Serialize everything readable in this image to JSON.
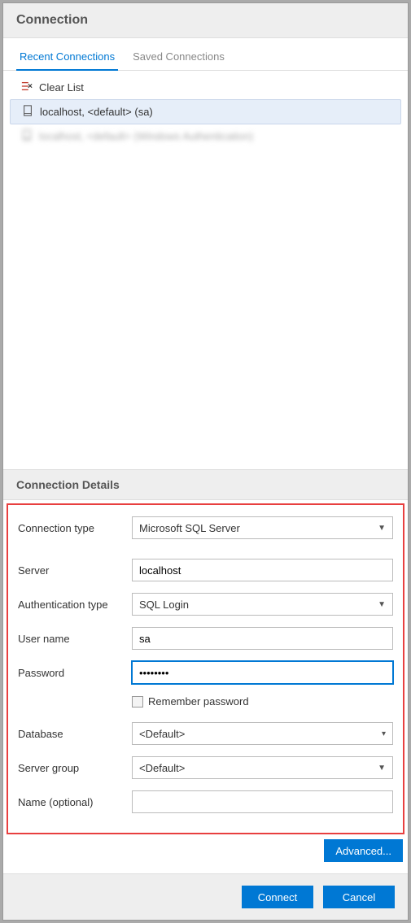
{
  "header": {
    "title": "Connection"
  },
  "tabs": {
    "recent": "Recent Connections",
    "saved": "Saved Connections"
  },
  "list": {
    "clear": "Clear List",
    "item1": "localhost, <default> (sa)",
    "item2": "localhost, <default> (Windows Authentication)"
  },
  "details": {
    "sectionTitle": "Connection Details",
    "labels": {
      "connType": "Connection type",
      "server": "Server",
      "authType": "Authentication type",
      "username": "User name",
      "password": "Password",
      "remember": "Remember password",
      "database": "Database",
      "serverGroup": "Server group",
      "name": "Name (optional)"
    },
    "values": {
      "connType": "Microsoft SQL Server",
      "server": "localhost",
      "authType": "SQL Login",
      "username": "sa",
      "password": "••••••••",
      "database": "<Default>",
      "serverGroup": "<Default>",
      "name": ""
    }
  },
  "buttons": {
    "advanced": "Advanced...",
    "connect": "Connect",
    "cancel": "Cancel"
  }
}
